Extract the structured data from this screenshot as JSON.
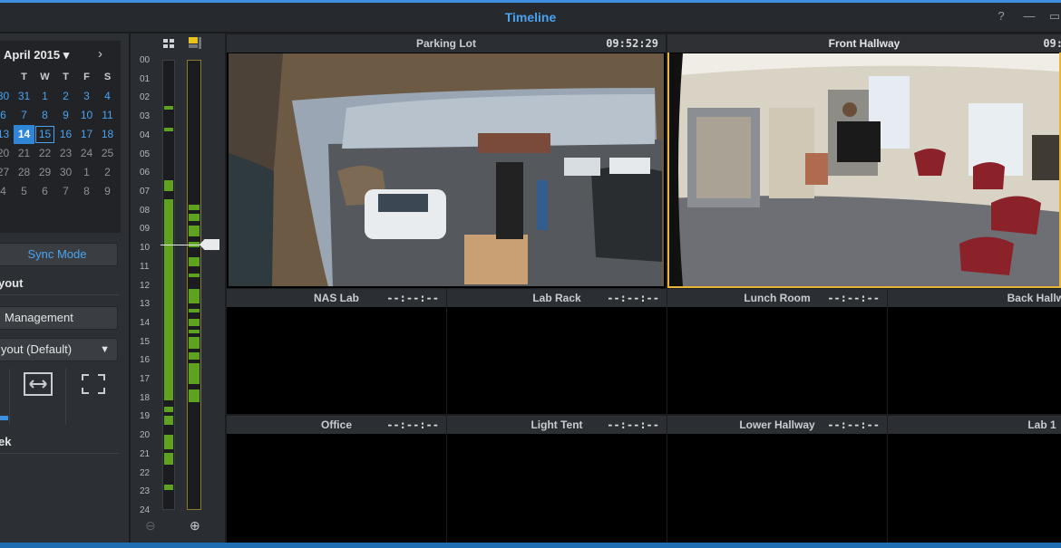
{
  "window": {
    "title": "Timeline",
    "help": "?",
    "minimize": "—",
    "maximize": "▭"
  },
  "calendar": {
    "month_label": "April 2015 ▾",
    "next": "›",
    "weekdays": [
      "T",
      "W",
      "T",
      "F",
      "S"
    ],
    "days": [
      [
        "30",
        "31",
        "1",
        "2",
        "3",
        "4"
      ],
      [
        "6",
        "7",
        "8",
        "9",
        "10",
        "11"
      ],
      [
        "13",
        "14",
        "15",
        "16",
        "17",
        "18"
      ],
      [
        "20",
        "21",
        "22",
        "23",
        "24",
        "25"
      ],
      [
        "27",
        "28",
        "29",
        "30",
        "1",
        "2"
      ],
      [
        "4",
        "5",
        "6",
        "7",
        "8",
        "9"
      ]
    ],
    "selected_day": "14",
    "today_day": "15"
  },
  "playback": {
    "prev": "⏮",
    "pause": "❚❚",
    "forward": "⏩",
    "end": "⏭"
  },
  "sync_mode": "Sync Mode",
  "layout_section": "yout",
  "management": "Management",
  "layout_select": "yout (Default)",
  "week_section": "ek",
  "timeline": {
    "hours": [
      "00",
      "01",
      "02",
      "03",
      "04",
      "05",
      "06",
      "07",
      "08",
      "09",
      "10",
      "11",
      "12",
      "13",
      "14",
      "15",
      "16",
      "17",
      "18",
      "19",
      "20",
      "21",
      "22",
      "23",
      "24"
    ],
    "zoom_out": "⊖",
    "zoom_in": "⊕",
    "left_recordings": [
      [
        2.4,
        2.6
      ],
      [
        3.6,
        3.8
      ],
      [
        6.4,
        7.0
      ],
      [
        7.4,
        18.2
      ],
      [
        18.5,
        18.8
      ],
      [
        19.0,
        19.5
      ],
      [
        20.0,
        20.8
      ],
      [
        21.0,
        21.6
      ],
      [
        22.7,
        23.0
      ]
    ],
    "right_recordings": [
      [
        7.7,
        8.0
      ],
      [
        8.2,
        8.6
      ],
      [
        8.8,
        9.4
      ],
      [
        9.7,
        10.0
      ],
      [
        10.5,
        11.0
      ],
      [
        11.4,
        11.6
      ],
      [
        12.2,
        13.0
      ],
      [
        13.3,
        13.5
      ],
      [
        13.8,
        14.2
      ],
      [
        14.4,
        14.6
      ],
      [
        14.8,
        15.4
      ],
      [
        15.6,
        16.0
      ],
      [
        16.2,
        17.3
      ],
      [
        17.6,
        18.3
      ]
    ]
  },
  "cameras": [
    {
      "name": "Parking Lot",
      "time": "09:52:29"
    },
    {
      "name": "Front Hallway",
      "time": "09:"
    },
    {
      "name": "NAS Lab",
      "time": "--:--:--"
    },
    {
      "name": "Lab Rack",
      "time": "--:--:--"
    },
    {
      "name": "Lunch Room",
      "time": "--:--:--"
    },
    {
      "name": "Back Hallway",
      "time": ""
    },
    {
      "name": "Office",
      "time": "--:--:--"
    },
    {
      "name": "Light Tent",
      "time": "--:--:--"
    },
    {
      "name": "Lower Hallway",
      "time": "--:--:--"
    },
    {
      "name": "Lab 1",
      "time": ""
    }
  ],
  "colors": {
    "accent": "#4aa3f0",
    "recording": "#5ea21f",
    "active_border": "#e8b537"
  }
}
